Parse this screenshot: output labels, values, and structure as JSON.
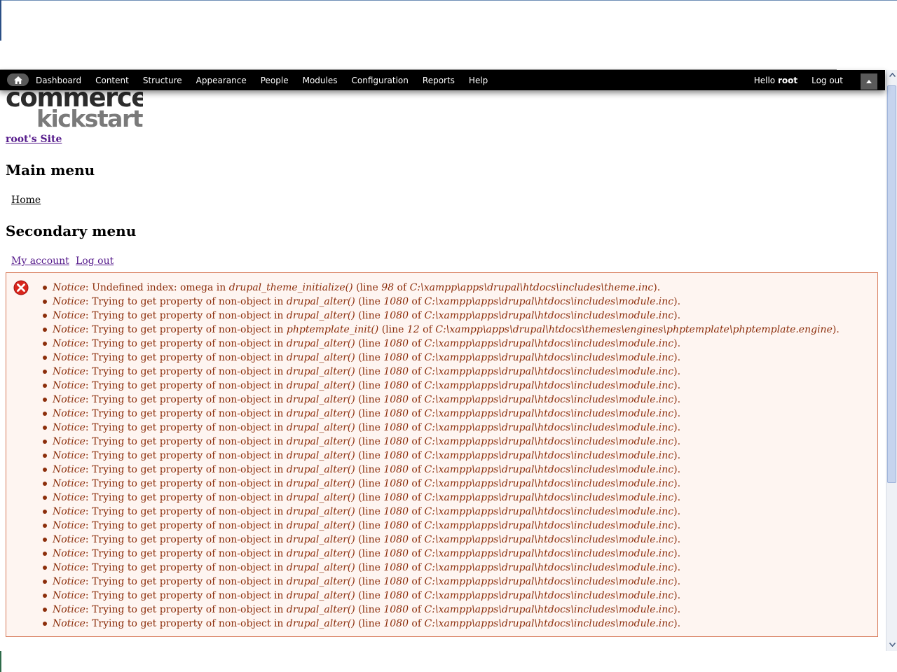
{
  "toolbar": {
    "home_icon": "home-icon",
    "nav": [
      "Dashboard",
      "Content",
      "Structure",
      "Appearance",
      "People",
      "Modules",
      "Configuration",
      "Reports",
      "Help"
    ],
    "hello_prefix": "Hello ",
    "user": "root",
    "logout": "Log out",
    "shortcut_icon": "triangle-up-icon"
  },
  "logo": {
    "line1": "commerce",
    "line2": "kickstart"
  },
  "site_name": "root's Site",
  "main_menu": {
    "title": "Main menu",
    "items": [
      "Home"
    ]
  },
  "secondary_menu": {
    "title": "Secondary menu",
    "items": [
      "My account",
      "Log out"
    ]
  },
  "messages": {
    "type": "error",
    "icon": "error-x-icon",
    "items": [
      {
        "label": "Notice",
        "text": ": Undefined index: omega in ",
        "func": "drupal_theme_initialize()",
        "line_prefix": " (line ",
        "line": "98",
        "of": " of ",
        "file": "C:\\xampp\\apps\\drupal\\htdocs\\includes\\theme.inc",
        "end": ")."
      },
      {
        "label": "Notice",
        "text": ": Trying to get property of non-object in ",
        "func": "drupal_alter()",
        "line_prefix": " (line ",
        "line": "1080",
        "of": " of ",
        "file": "C:\\xampp\\apps\\drupal\\htdocs\\includes\\module.inc",
        "end": ")."
      },
      {
        "label": "Notice",
        "text": ": Trying to get property of non-object in ",
        "func": "drupal_alter()",
        "line_prefix": " (line ",
        "line": "1080",
        "of": " of ",
        "file": "C:\\xampp\\apps\\drupal\\htdocs\\includes\\module.inc",
        "end": ")."
      },
      {
        "label": "Notice",
        "text": ": Trying to get property of non-object in ",
        "func": "phptemplate_init()",
        "line_prefix": " (line ",
        "line": "12",
        "of": " of ",
        "file": "C:\\xampp\\apps\\drupal\\htdocs\\themes\\engines\\phptemplate\\phptemplate.engine",
        "end": ")."
      },
      {
        "label": "Notice",
        "text": ": Trying to get property of non-object in ",
        "func": "drupal_alter()",
        "line_prefix": " (line ",
        "line": "1080",
        "of": " of ",
        "file": "C:\\xampp\\apps\\drupal\\htdocs\\includes\\module.inc",
        "end": ")."
      },
      {
        "label": "Notice",
        "text": ": Trying to get property of non-object in ",
        "func": "drupal_alter()",
        "line_prefix": " (line ",
        "line": "1080",
        "of": " of ",
        "file": "C:\\xampp\\apps\\drupal\\htdocs\\includes\\module.inc",
        "end": ")."
      },
      {
        "label": "Notice",
        "text": ": Trying to get property of non-object in ",
        "func": "drupal_alter()",
        "line_prefix": " (line ",
        "line": "1080",
        "of": " of ",
        "file": "C:\\xampp\\apps\\drupal\\htdocs\\includes\\module.inc",
        "end": ")."
      },
      {
        "label": "Notice",
        "text": ": Trying to get property of non-object in ",
        "func": "drupal_alter()",
        "line_prefix": " (line ",
        "line": "1080",
        "of": " of ",
        "file": "C:\\xampp\\apps\\drupal\\htdocs\\includes\\module.inc",
        "end": ")."
      },
      {
        "label": "Notice",
        "text": ": Trying to get property of non-object in ",
        "func": "drupal_alter()",
        "line_prefix": " (line ",
        "line": "1080",
        "of": " of ",
        "file": "C:\\xampp\\apps\\drupal\\htdocs\\includes\\module.inc",
        "end": ")."
      },
      {
        "label": "Notice",
        "text": ": Trying to get property of non-object in ",
        "func": "drupal_alter()",
        "line_prefix": " (line ",
        "line": "1080",
        "of": " of ",
        "file": "C:\\xampp\\apps\\drupal\\htdocs\\includes\\module.inc",
        "end": ")."
      },
      {
        "label": "Notice",
        "text": ": Trying to get property of non-object in ",
        "func": "drupal_alter()",
        "line_prefix": " (line ",
        "line": "1080",
        "of": " of ",
        "file": "C:\\xampp\\apps\\drupal\\htdocs\\includes\\module.inc",
        "end": ")."
      },
      {
        "label": "Notice",
        "text": ": Trying to get property of non-object in ",
        "func": "drupal_alter()",
        "line_prefix": " (line ",
        "line": "1080",
        "of": " of ",
        "file": "C:\\xampp\\apps\\drupal\\htdocs\\includes\\module.inc",
        "end": ")."
      },
      {
        "label": "Notice",
        "text": ": Trying to get property of non-object in ",
        "func": "drupal_alter()",
        "line_prefix": " (line ",
        "line": "1080",
        "of": " of ",
        "file": "C:\\xampp\\apps\\drupal\\htdocs\\includes\\module.inc",
        "end": ")."
      },
      {
        "label": "Notice",
        "text": ": Trying to get property of non-object in ",
        "func": "drupal_alter()",
        "line_prefix": " (line ",
        "line": "1080",
        "of": " of ",
        "file": "C:\\xampp\\apps\\drupal\\htdocs\\includes\\module.inc",
        "end": ")."
      },
      {
        "label": "Notice",
        "text": ": Trying to get property of non-object in ",
        "func": "drupal_alter()",
        "line_prefix": " (line ",
        "line": "1080",
        "of": " of ",
        "file": "C:\\xampp\\apps\\drupal\\htdocs\\includes\\module.inc",
        "end": ")."
      },
      {
        "label": "Notice",
        "text": ": Trying to get property of non-object in ",
        "func": "drupal_alter()",
        "line_prefix": " (line ",
        "line": "1080",
        "of": " of ",
        "file": "C:\\xampp\\apps\\drupal\\htdocs\\includes\\module.inc",
        "end": ")."
      },
      {
        "label": "Notice",
        "text": ": Trying to get property of non-object in ",
        "func": "drupal_alter()",
        "line_prefix": " (line ",
        "line": "1080",
        "of": " of ",
        "file": "C:\\xampp\\apps\\drupal\\htdocs\\includes\\module.inc",
        "end": ")."
      },
      {
        "label": "Notice",
        "text": ": Trying to get property of non-object in ",
        "func": "drupal_alter()",
        "line_prefix": " (line ",
        "line": "1080",
        "of": " of ",
        "file": "C:\\xampp\\apps\\drupal\\htdocs\\includes\\module.inc",
        "end": ")."
      },
      {
        "label": "Notice",
        "text": ": Trying to get property of non-object in ",
        "func": "drupal_alter()",
        "line_prefix": " (line ",
        "line": "1080",
        "of": " of ",
        "file": "C:\\xampp\\apps\\drupal\\htdocs\\includes\\module.inc",
        "end": ")."
      },
      {
        "label": "Notice",
        "text": ": Trying to get property of non-object in ",
        "func": "drupal_alter()",
        "line_prefix": " (line ",
        "line": "1080",
        "of": " of ",
        "file": "C:\\xampp\\apps\\drupal\\htdocs\\includes\\module.inc",
        "end": ")."
      },
      {
        "label": "Notice",
        "text": ": Trying to get property of non-object in ",
        "func": "drupal_alter()",
        "line_prefix": " (line ",
        "line": "1080",
        "of": " of ",
        "file": "C:\\xampp\\apps\\drupal\\htdocs\\includes\\module.inc",
        "end": ")."
      },
      {
        "label": "Notice",
        "text": ": Trying to get property of non-object in ",
        "func": "drupal_alter()",
        "line_prefix": " (line ",
        "line": "1080",
        "of": " of ",
        "file": "C:\\xampp\\apps\\drupal\\htdocs\\includes\\module.inc",
        "end": ")."
      },
      {
        "label": "Notice",
        "text": ": Trying to get property of non-object in ",
        "func": "drupal_alter()",
        "line_prefix": " (line ",
        "line": "1080",
        "of": " of ",
        "file": "C:\\xampp\\apps\\drupal\\htdocs\\includes\\module.inc",
        "end": ")."
      },
      {
        "label": "Notice",
        "text": ": Trying to get property of non-object in ",
        "func": "drupal_alter()",
        "line_prefix": " (line ",
        "line": "1080",
        "of": " of ",
        "file": "C:\\xampp\\apps\\drupal\\htdocs\\includes\\module.inc",
        "end": ")."
      },
      {
        "label": "Notice",
        "text": ": Trying to get property of non-object in ",
        "func": "drupal_alter()",
        "line_prefix": " (line ",
        "line": "1080",
        "of": " of ",
        "file": "C:\\xampp\\apps\\drupal\\htdocs\\includes\\module.inc",
        "end": ")."
      }
    ]
  },
  "colors": {
    "toolbar_bg": "#000000",
    "message_bg": "#fef5f1",
    "message_text": "#8c2e0b",
    "message_border": "#d77a5a",
    "link_visited": "#551a8b"
  }
}
